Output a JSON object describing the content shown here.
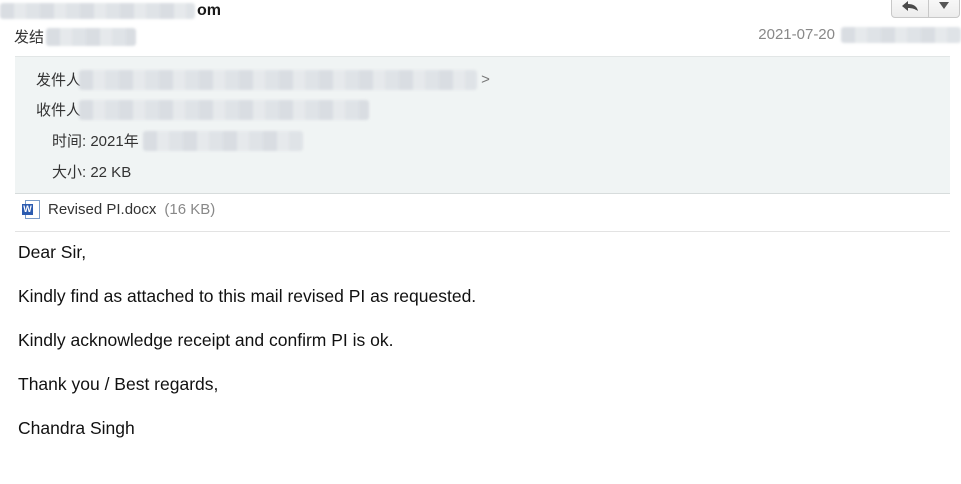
{
  "header": {
    "subject_suffix": "om",
    "sender_prefix": "发结",
    "date": "2021-07-20",
    "actions": {
      "reply_icon": "reply-icon",
      "more_icon": "chevron-down-icon"
    }
  },
  "details": {
    "from_label": "发件人:",
    "from_suffix": ">",
    "to_label": "收件人:",
    "time_label": "时间: 2021年",
    "size_label": "大小: 22 KB"
  },
  "attachment": {
    "name": "Revised PI.docx",
    "size": "(16 KB)",
    "icon": "word-document-icon"
  },
  "body": {
    "lines": [
      "Dear Sir,",
      "Kindly find as attached to this mail revised PI as requested.",
      "Kindly acknowledge receipt and confirm PI is ok.",
      "Thank you / Best regards,",
      "Chandra Singh"
    ]
  }
}
